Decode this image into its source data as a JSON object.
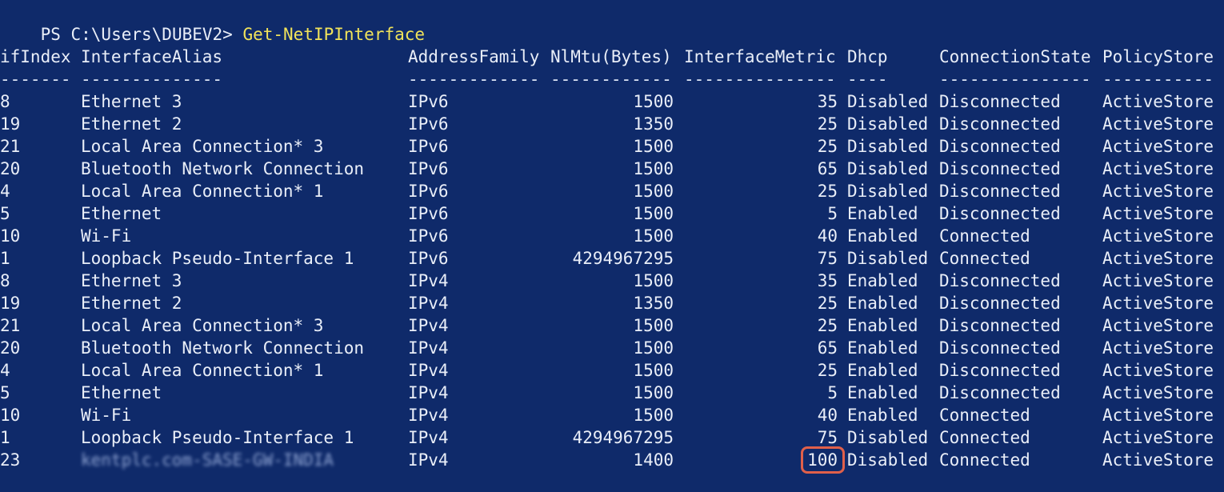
{
  "prompt": {
    "path": "PS C:\\Users\\DUBEV2> ",
    "command": "Get-NetIPInterface"
  },
  "columns": [
    {
      "header": "ifIndex",
      "dashes": "-------"
    },
    {
      "header": "InterfaceAlias",
      "dashes": "--------------"
    },
    {
      "header": "AddressFamily",
      "dashes": "-------------"
    },
    {
      "header": "NlMtu(Bytes)",
      "dashes": "------------"
    },
    {
      "header": "InterfaceMetric",
      "dashes": "---------------"
    },
    {
      "header": "Dhcp",
      "dashes": "----"
    },
    {
      "header": "ConnectionState",
      "dashes": "---------------"
    },
    {
      "header": "PolicyStore",
      "dashes": "-----------"
    }
  ],
  "rows": [
    {
      "ifIndex": "8",
      "alias": "Ethernet 3",
      "family": "IPv6",
      "mtu": "1500",
      "metric": "35",
      "dhcp": "Disabled",
      "state": "Disconnected",
      "store": "ActiveStore"
    },
    {
      "ifIndex": "19",
      "alias": "Ethernet 2",
      "family": "IPv6",
      "mtu": "1350",
      "metric": "25",
      "dhcp": "Disabled",
      "state": "Disconnected",
      "store": "ActiveStore"
    },
    {
      "ifIndex": "21",
      "alias": "Local Area Connection* 3",
      "family": "IPv6",
      "mtu": "1500",
      "metric": "25",
      "dhcp": "Disabled",
      "state": "Disconnected",
      "store": "ActiveStore"
    },
    {
      "ifIndex": "20",
      "alias": "Bluetooth Network Connection",
      "family": "IPv6",
      "mtu": "1500",
      "metric": "65",
      "dhcp": "Disabled",
      "state": "Disconnected",
      "store": "ActiveStore"
    },
    {
      "ifIndex": "4",
      "alias": "Local Area Connection* 1",
      "family": "IPv6",
      "mtu": "1500",
      "metric": "25",
      "dhcp": "Disabled",
      "state": "Disconnected",
      "store": "ActiveStore"
    },
    {
      "ifIndex": "5",
      "alias": "Ethernet",
      "family": "IPv6",
      "mtu": "1500",
      "metric": "5",
      "dhcp": "Enabled",
      "state": "Disconnected",
      "store": "ActiveStore"
    },
    {
      "ifIndex": "10",
      "alias": "Wi-Fi",
      "family": "IPv6",
      "mtu": "1500",
      "metric": "40",
      "dhcp": "Enabled",
      "state": "Connected",
      "store": "ActiveStore"
    },
    {
      "ifIndex": "1",
      "alias": "Loopback Pseudo-Interface 1",
      "family": "IPv6",
      "mtu": "4294967295",
      "metric": "75",
      "dhcp": "Disabled",
      "state": "Connected",
      "store": "ActiveStore"
    },
    {
      "ifIndex": "8",
      "alias": "Ethernet 3",
      "family": "IPv4",
      "mtu": "1500",
      "metric": "35",
      "dhcp": "Enabled",
      "state": "Disconnected",
      "store": "ActiveStore"
    },
    {
      "ifIndex": "19",
      "alias": "Ethernet 2",
      "family": "IPv4",
      "mtu": "1350",
      "metric": "25",
      "dhcp": "Enabled",
      "state": "Disconnected",
      "store": "ActiveStore"
    },
    {
      "ifIndex": "21",
      "alias": "Local Area Connection* 3",
      "family": "IPv4",
      "mtu": "1500",
      "metric": "25",
      "dhcp": "Enabled",
      "state": "Disconnected",
      "store": "ActiveStore"
    },
    {
      "ifIndex": "20",
      "alias": "Bluetooth Network Connection",
      "family": "IPv4",
      "mtu": "1500",
      "metric": "65",
      "dhcp": "Enabled",
      "state": "Disconnected",
      "store": "ActiveStore"
    },
    {
      "ifIndex": "4",
      "alias": "Local Area Connection* 1",
      "family": "IPv4",
      "mtu": "1500",
      "metric": "25",
      "dhcp": "Enabled",
      "state": "Disconnected",
      "store": "ActiveStore"
    },
    {
      "ifIndex": "5",
      "alias": "Ethernet",
      "family": "IPv4",
      "mtu": "1500",
      "metric": "5",
      "dhcp": "Enabled",
      "state": "Disconnected",
      "store": "ActiveStore"
    },
    {
      "ifIndex": "10",
      "alias": "Wi-Fi",
      "family": "IPv4",
      "mtu": "1500",
      "metric": "40",
      "dhcp": "Enabled",
      "state": "Connected",
      "store": "ActiveStore"
    },
    {
      "ifIndex": "1",
      "alias": "Loopback Pseudo-Interface 1",
      "family": "IPv4",
      "mtu": "4294967295",
      "metric": "75",
      "dhcp": "Disabled",
      "state": "Connected",
      "store": "ActiveStore"
    },
    {
      "ifIndex": "23",
      "alias": "kentplc.com-SASE-GW-INDIA",
      "family": "IPv4",
      "mtu": "1400",
      "metric": "100",
      "dhcp": "Disabled",
      "state": "Connected",
      "store": "ActiveStore",
      "alias_blurred": true,
      "metric_highlighted": true
    }
  ],
  "colors": {
    "background": "#0f2a6a",
    "text": "#e9eef8",
    "command": "#f1e35a",
    "highlight": "#e0604a"
  }
}
